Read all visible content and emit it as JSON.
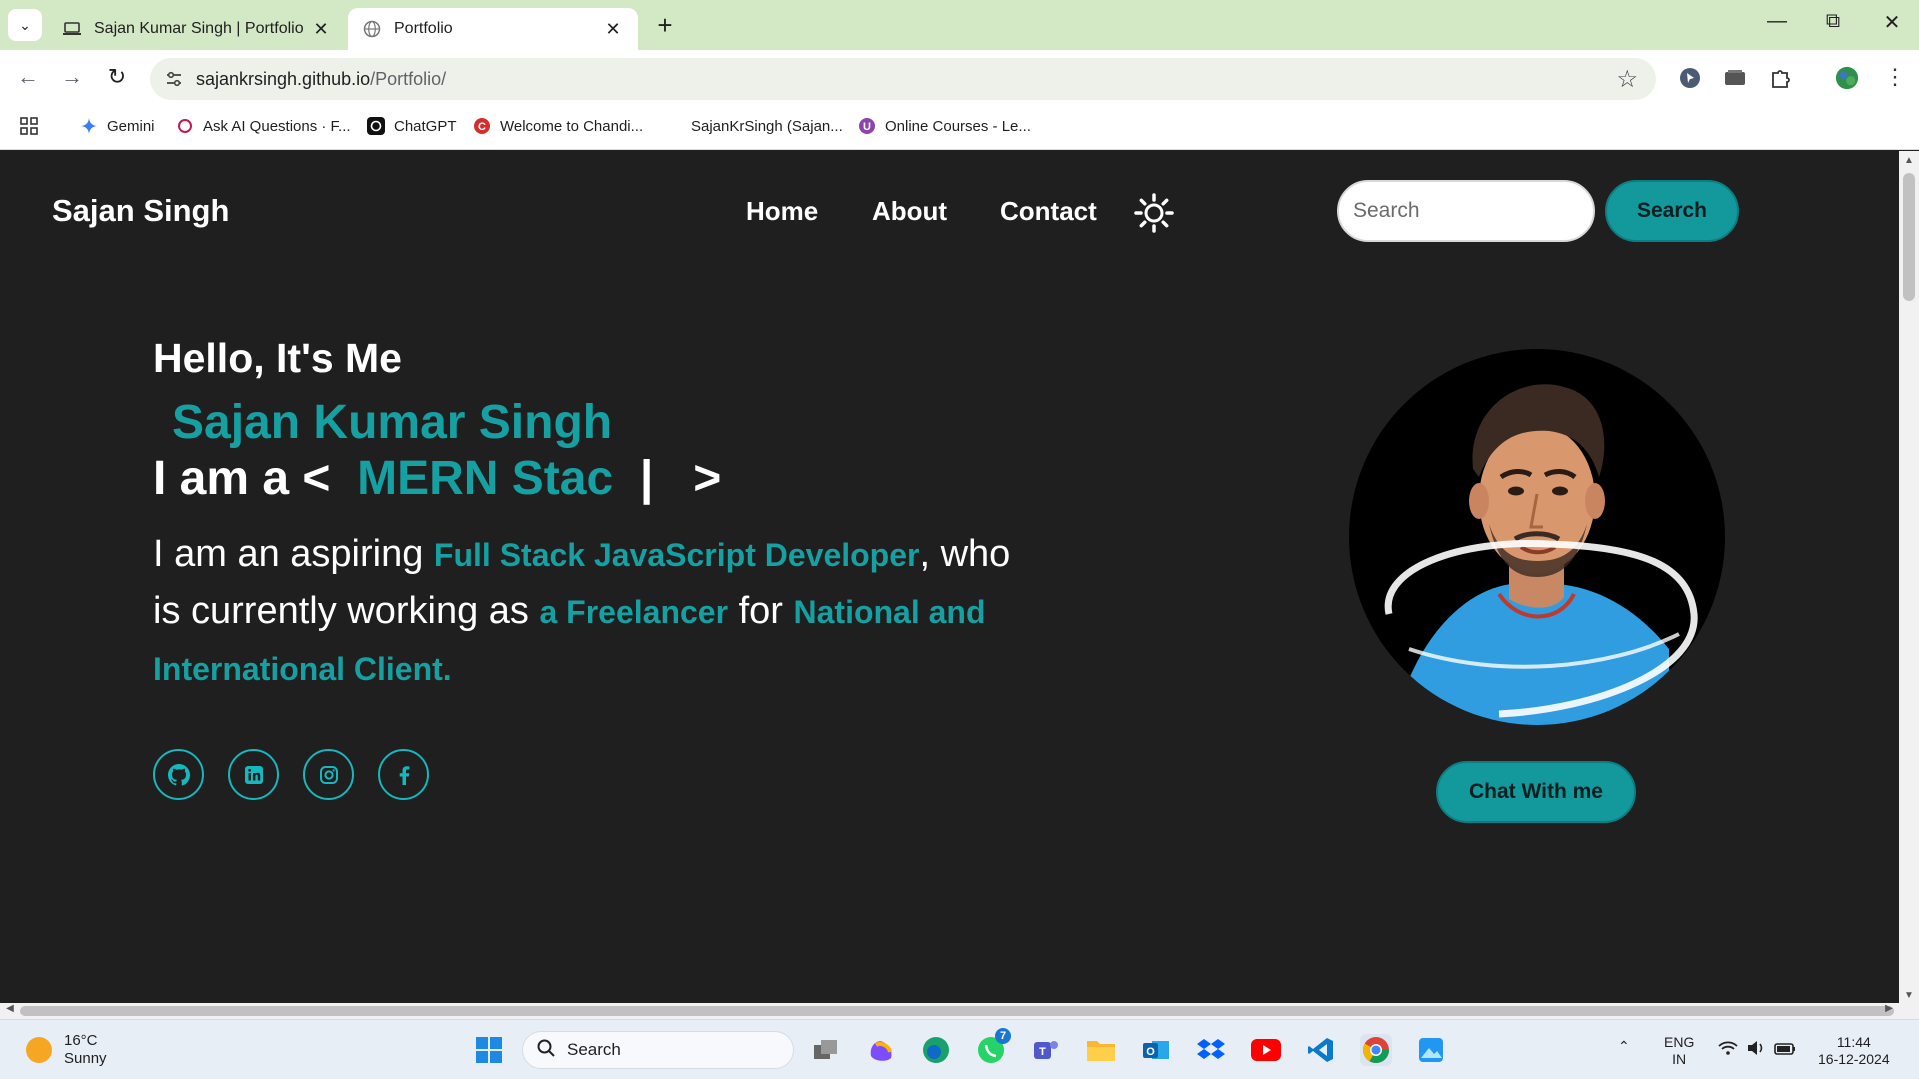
{
  "browser": {
    "tabs": [
      {
        "title": "Sajan Kumar Singh | Portfolio",
        "active": false
      },
      {
        "title": "Portfolio",
        "active": true
      }
    ],
    "url_host": "sajankrsingh.github.io",
    "url_path": "/Portfolio/",
    "bookmarks": [
      {
        "label": "Gemini",
        "icon": "gemini-icon"
      },
      {
        "label": "Ask AI Questions · F...",
        "icon": "ask-ai-icon"
      },
      {
        "label": "ChatGPT",
        "icon": "chatgpt-icon"
      },
      {
        "label": "Welcome to Chandi...",
        "icon": "chandigarh-icon"
      },
      {
        "label": "SajanKrSingh (Sajan...",
        "icon": "github-icon"
      },
      {
        "label": "Online Courses - Le...",
        "icon": "udemy-icon"
      }
    ]
  },
  "site": {
    "brand": "Sajan Singh",
    "nav": [
      "Home",
      "About",
      "Contact"
    ],
    "search_placeholder": "Search",
    "search_button": "Search",
    "greeting": "Hello, It's Me",
    "name": "Sajan Kumar Singh",
    "typing_prefix": "I am a <  ",
    "typing_text": "MERN Stac",
    "typing_suffix": "  |   >",
    "intro_1": "I am an aspiring ",
    "intro_hl_1": "Full Stack JavaScript Developer",
    "intro_2": ", who is currently working as ",
    "intro_hl_2": "a Freelancer",
    "intro_3": " for ",
    "intro_hl_3": "National and International Client.",
    "socials": [
      "github-icon",
      "linkedin-icon",
      "instagram-icon",
      "facebook-icon"
    ],
    "chat_button": "Chat With me",
    "accent_color": "#16a0a2"
  },
  "taskbar": {
    "weather_temp": "16°C",
    "weather_desc": "Sunny",
    "search_label": "Search",
    "whatsapp_badge": "7",
    "lang_1": "ENG",
    "lang_2": "IN",
    "time": "11:44",
    "date": "16-12-2024"
  }
}
